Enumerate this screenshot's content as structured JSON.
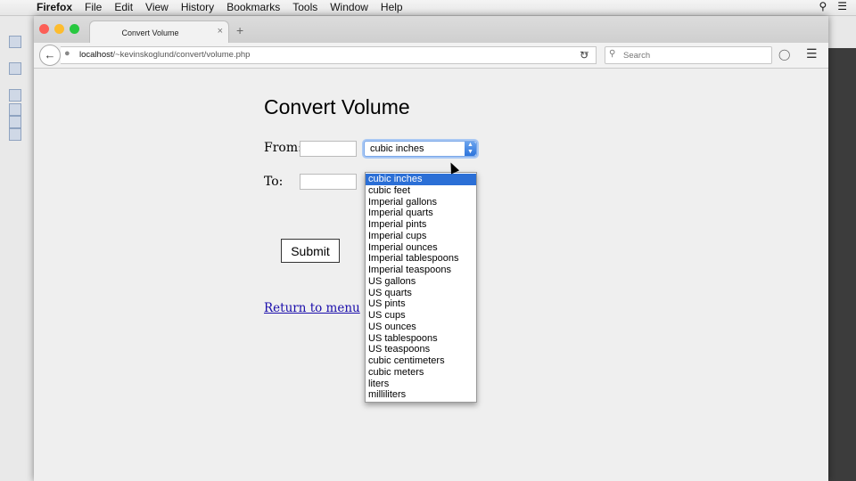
{
  "menubar": {
    "app": "Firefox",
    "items": [
      "File",
      "Edit",
      "View",
      "History",
      "Bookmarks",
      "Tools",
      "Window",
      "Help"
    ]
  },
  "browser": {
    "tab_title": "Convert Volume",
    "tab_close": "×",
    "new_tab": "+",
    "url_host": "localhost",
    "url_path": "/~kevinskoglund/convert/volume.php",
    "search_placeholder": "Search"
  },
  "page": {
    "title": "Convert Volume",
    "from_label": "From:",
    "to_label": "To:",
    "from_value": "",
    "to_value": "",
    "selected_unit": "cubic inches",
    "options": [
      "cubic inches",
      "cubic feet",
      "Imperial gallons",
      "Imperial quarts",
      "Imperial pints",
      "Imperial cups",
      "Imperial ounces",
      "Imperial tablespoons",
      "Imperial teaspoons",
      "US gallons",
      "US quarts",
      "US pints",
      "US cups",
      "US ounces",
      "US tablespoons",
      "US teaspoons",
      "cubic centimeters",
      "cubic meters",
      "liters",
      "milliliters"
    ],
    "submit_label": "Submit",
    "return_link": "Return to menu"
  },
  "colors": {
    "selection": "#2b6fd6",
    "link": "#1a0dab",
    "close_light": "#fc5f57",
    "min_light": "#fdbc2e",
    "max_light": "#28c840"
  }
}
